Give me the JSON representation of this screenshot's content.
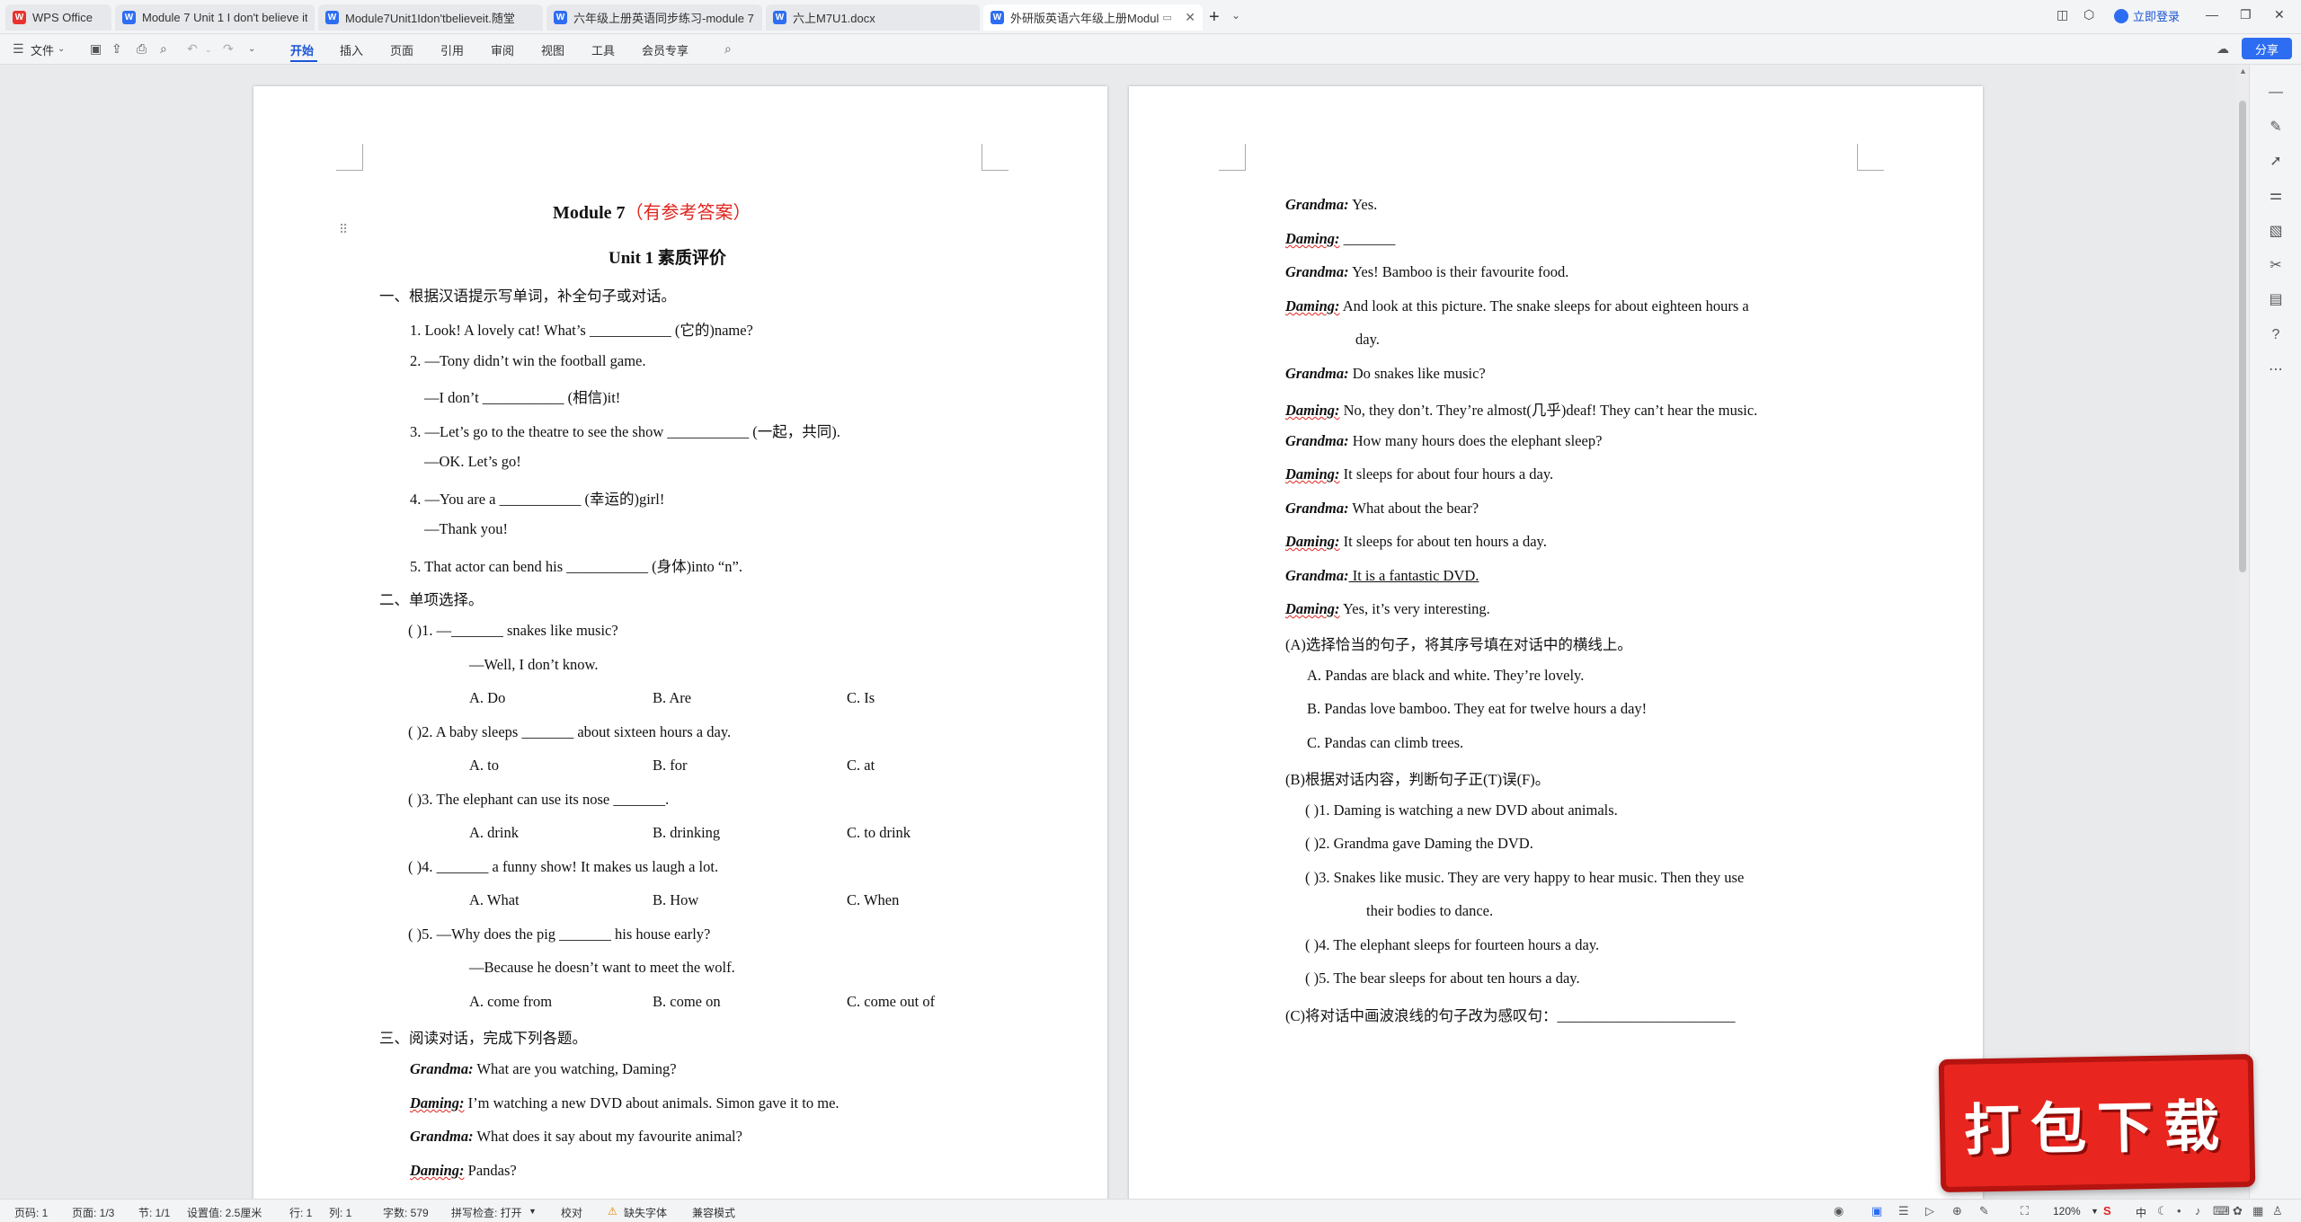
{
  "tabs": [
    {
      "label": "WPS Office",
      "icon": "wps-logo-icon"
    },
    {
      "label": "Module 7 Unit 1 I don't believe it",
      "icon": "word-doc-icon"
    },
    {
      "label": "Module7Unit1Idon'tbelieveit.随堂",
      "icon": "word-doc-icon"
    },
    {
      "label": "六年级上册英语同步练习-module 7",
      "icon": "word-doc-icon"
    },
    {
      "label": "六上M7U1.docx",
      "icon": "word-doc-icon"
    },
    {
      "label": "外研版英语六年级上册Modul",
      "icon": "word-doc-icon"
    }
  ],
  "header": {
    "login_label": "立即登录",
    "share_label": "分享"
  },
  "ribbon": {
    "file_menu": "文件",
    "tabs": [
      "开始",
      "插入",
      "页面",
      "引用",
      "审阅",
      "视图",
      "工具",
      "会员专享"
    ]
  },
  "page1": {
    "title_main": "Module 7",
    "title_note": "（有参考答案）",
    "subtitle": "Unit 1  素质评价",
    "sec1": "一、根据汉语提示写单词，补全句子或对话。",
    "q1": "1. Look! A lovely cat! What’s ___________ (它的)name?",
    "q2a": "2. —Tony didn’t win the football game.",
    "q2b": "—I don’t ___________ (相信)it!",
    "q3a": "3. —Let’s go to the theatre to see the show ___________ (一起，共同).",
    "q3b": "—OK. Let’s go!",
    "q4a": "4. —You are a ___________ (幸运的)girl!",
    "q4b": "—Thank you!",
    "q5": "5. That actor can bend his ___________ (身体)into “n”.",
    "sec2": "二、单项选择。",
    "mc1": "(        )1. —_______ snakes like music?",
    "mc1b": "—Well, I don’t know.",
    "mc1_opts": [
      "A. Do",
      "B. Are",
      "C. Is"
    ],
    "mc2": "(        )2. A baby sleeps _______ about sixteen hours a day.",
    "mc2_opts": [
      "A. to",
      "B. for",
      "C. at"
    ],
    "mc3": "(        )3. The elephant can use its nose _______.",
    "mc3_opts": [
      "A. drink",
      "B. drinking",
      "C. to drink"
    ],
    "mc4": "(        )4. _______ a funny show! It makes us laugh a lot.",
    "mc4_opts": [
      "A. What",
      "B. How",
      "C. When"
    ],
    "mc5": "(        )5. —Why does the pig _______ his house early?",
    "mc5b": "—Because he doesn’t want to meet the wolf.",
    "mc5_opts": [
      "A. come from",
      "B. come on",
      "C. come out of"
    ],
    "sec3": "三、阅读对话，完成下列各题。",
    "dialog": [
      {
        "speaker": "Grandma:",
        "line": " What are you watching, Daming?"
      },
      {
        "speaker": "Daming:",
        "line": " I’m watching a new DVD about animals. Simon gave it to me."
      },
      {
        "speaker": "Grandma:",
        "line": " What does it say about my favourite animal?"
      },
      {
        "speaker": "Daming:",
        "line": " Pandas?"
      }
    ]
  },
  "page2": {
    "dialog": [
      {
        "speaker": "Grandma:",
        "line": " Yes."
      },
      {
        "speaker": "Daming:",
        "line": " _______"
      },
      {
        "speaker": "Grandma:",
        "line": " Yes! Bamboo is their favourite food."
      },
      {
        "speaker": "Daming:",
        "line": " And look at this picture. The snake sleeps for about eighteen hours a"
      },
      {
        "speaker": "",
        "line": "day."
      },
      {
        "speaker": "Grandma:",
        "line": " Do snakes like music?"
      },
      {
        "speaker": "Daming:",
        "line": " No, they don’t. They’re almost(几乎)deaf! They can’t hear the music."
      },
      {
        "speaker": "Grandma:",
        "line": " How many hours does the elephant sleep?"
      },
      {
        "speaker": "Daming:",
        "line": " It sleeps for about four hours a day."
      },
      {
        "speaker": "Grandma:",
        "line": " What about the bear?"
      },
      {
        "speaker": "Daming:",
        "line": " It sleeps for about ten hours a day."
      },
      {
        "speaker": "Grandma:",
        "line": " It is a fantastic DVD."
      },
      {
        "speaker": "Daming:",
        "line": " Yes, it’s very interesting."
      }
    ],
    "partA": "(A)选择恰当的句子，将其序号填在对话中的横线上。",
    "optA": "A. Pandas are black and white. They’re lovely.",
    "optB": "B. Pandas love bamboo. They eat for twelve hours a day!",
    "optC": "C. Pandas can climb trees.",
    "partB": "(B)根据对话内容，判断句子正(T)误(F)。",
    "tf1": "(        )1. Daming is watching a new DVD about animals.",
    "tf2": "(        )2. Grandma gave Daming the DVD.",
    "tf3a": "(        )3. Snakes like music. They are very happy to hear music. Then they use",
    "tf3b": "their bodies to dance.",
    "tf4": "(        )4. The elephant sleeps for fourteen hours a day.",
    "tf5": "(        )5. The bear sleeps for about ten hours a day.",
    "partC": "(C)将对话中画波浪线的句子改为感叹句：________________________"
  },
  "statusbar": {
    "page": "页码: 1",
    "pages": "页面: 1/3",
    "section": "节: 1/1",
    "setting": "设置值: 2.5厘米",
    "row": "行: 1",
    "col": "列: 1",
    "words": "字数: 579",
    "spell": "拼写检查: 打开",
    "proof": "校对",
    "missing_font": "缺失字体",
    "compat": "兼容模式",
    "zoom": "120%"
  },
  "download_badge": "打包下载",
  "colors": {
    "accent": "#2d6df2",
    "red": "#e0251f",
    "badge": "#e8261f"
  }
}
